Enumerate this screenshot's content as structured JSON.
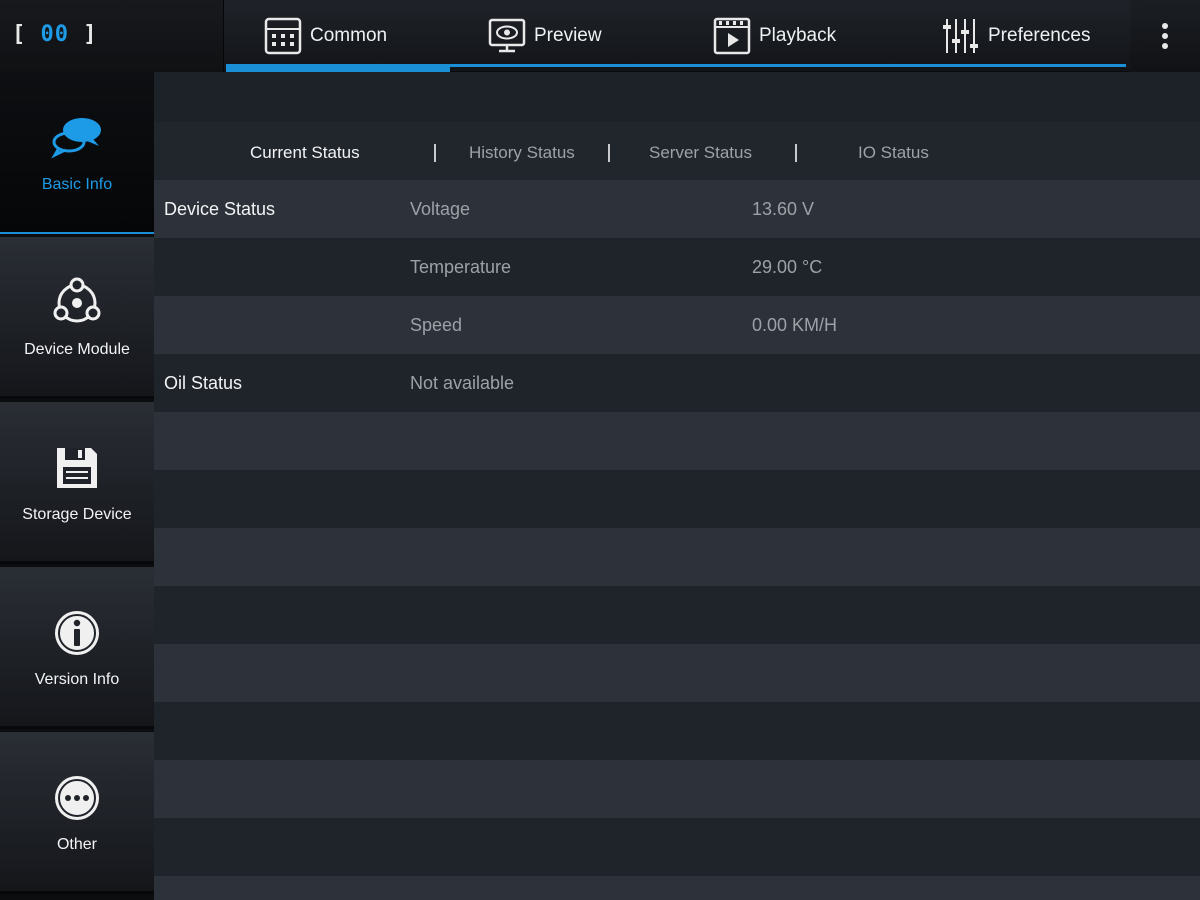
{
  "logo": {
    "left": "[",
    "digits": "00",
    "right": "]"
  },
  "top_tabs": [
    {
      "label": "Common",
      "icon": "grid-icon",
      "active": true
    },
    {
      "label": "Preview",
      "icon": "monitor-eye-icon",
      "active": false
    },
    {
      "label": "Playback",
      "icon": "film-play-icon",
      "active": false
    },
    {
      "label": "Preferences",
      "icon": "sliders-icon",
      "active": false
    }
  ],
  "sidebar": {
    "items": [
      {
        "label": "Basic Info",
        "icon": "chat-bubbles-icon",
        "active": true
      },
      {
        "label": "Device Module",
        "icon": "module-network-icon",
        "active": false
      },
      {
        "label": "Storage Device",
        "icon": "floppy-disk-icon",
        "active": false
      },
      {
        "label": "Version Info",
        "icon": "info-icon",
        "active": false
      },
      {
        "label": "Other",
        "icon": "ellipsis-icon",
        "active": false
      }
    ]
  },
  "sub_tabs": [
    {
      "label": "Current Status",
      "active": true
    },
    {
      "label": "History Status",
      "active": false
    },
    {
      "label": "Server Status",
      "active": false
    },
    {
      "label": "IO Status",
      "active": false
    }
  ],
  "status_rows": [
    {
      "name": "Device Status",
      "key": "Voltage",
      "value": "13.60 V"
    },
    {
      "name": "",
      "key": "Temperature",
      "value": "29.00 °C"
    },
    {
      "name": "",
      "key": "Speed",
      "value": "0.00 KM/H"
    },
    {
      "name": "Oil Status",
      "key": "Not available",
      "value": ""
    }
  ],
  "colors": {
    "accent": "#1a8fd6",
    "row_light": "#2d323a",
    "row_dark": "#1f232a"
  }
}
